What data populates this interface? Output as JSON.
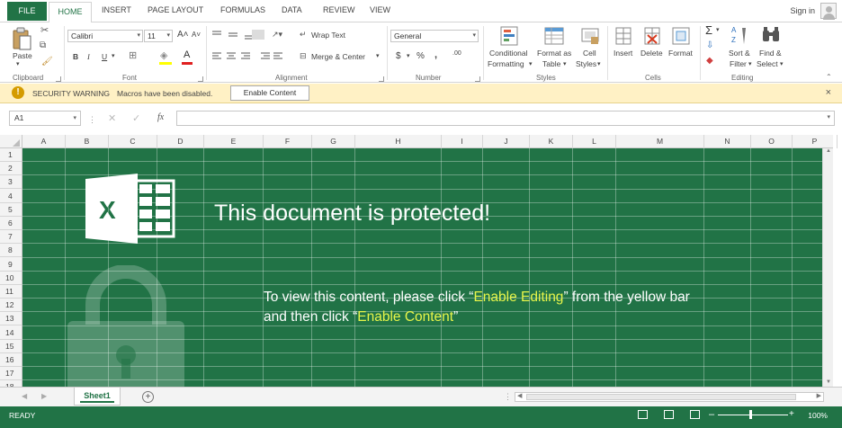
{
  "ribbon_tabs": [
    "FILE",
    "HOME",
    "INSERT",
    "PAGE LAYOUT",
    "FORMULAS",
    "DATA",
    "REVIEW",
    "VIEW"
  ],
  "account": {
    "signin": "Sign in"
  },
  "ribbon": {
    "clipboard": {
      "paste": "Paste",
      "label": "Clipboard"
    },
    "font": {
      "name": "Calibri",
      "size": "11",
      "bold": "B",
      "italic": "I",
      "underline": "U",
      "grow": "A˄",
      "shrink": "A˅",
      "label": "Font"
    },
    "alignment": {
      "wrap_text": "Wrap Text",
      "merge_center": "Merge & Center",
      "label": "Alignment"
    },
    "number": {
      "format": "General",
      "currency": "$",
      "percent": "%",
      "comma": ",",
      "inc_dec": ".00",
      "label": "Number"
    },
    "styles": {
      "conditional": "Conditional",
      "formatting": "Formatting",
      "format_as": "Format as",
      "table": "Table",
      "cell": "Cell",
      "cell_styles": "Styles",
      "label": "Styles"
    },
    "cells": {
      "insert": "Insert",
      "delete": "Delete",
      "format": "Format",
      "label": "Cells"
    },
    "editing": {
      "sort": "Sort &",
      "filter": "Filter",
      "find": "Find &",
      "select": "Select",
      "label": "Editing"
    }
  },
  "security_bar": {
    "title": "SECURITY WARNING",
    "message": "Macros have been disabled.",
    "button": "Enable Content",
    "close": "×"
  },
  "formula_bar": {
    "name_box": "A1",
    "fx": "fx",
    "value": ""
  },
  "columns": [
    "A",
    "B",
    "C",
    "D",
    "E",
    "F",
    "G",
    "H",
    "I",
    "J",
    "K",
    "L",
    "M",
    "N",
    "O",
    "P"
  ],
  "rows": [
    "1",
    "2",
    "3",
    "4",
    "5",
    "6",
    "7",
    "8",
    "9",
    "10",
    "11",
    "12",
    "13",
    "14",
    "15",
    "16",
    "17",
    "18"
  ],
  "content": {
    "headline": "This document is protected!",
    "line1_pre": "To view this content, please click “",
    "line1_hl": "Enable Editing",
    "line1_post": "” from the yellow bar",
    "line2_pre": "and then click “",
    "line2_hl": "Enable Content",
    "line2_post": "”"
  },
  "sheet_tabs": {
    "active": "Sheet1",
    "add": "+"
  },
  "status_bar": {
    "mode": "READY",
    "zoom": "100%"
  },
  "colors": {
    "excel_green": "#217346",
    "highlight": "#e8f54a",
    "warning_bar": "#fff1c5"
  }
}
